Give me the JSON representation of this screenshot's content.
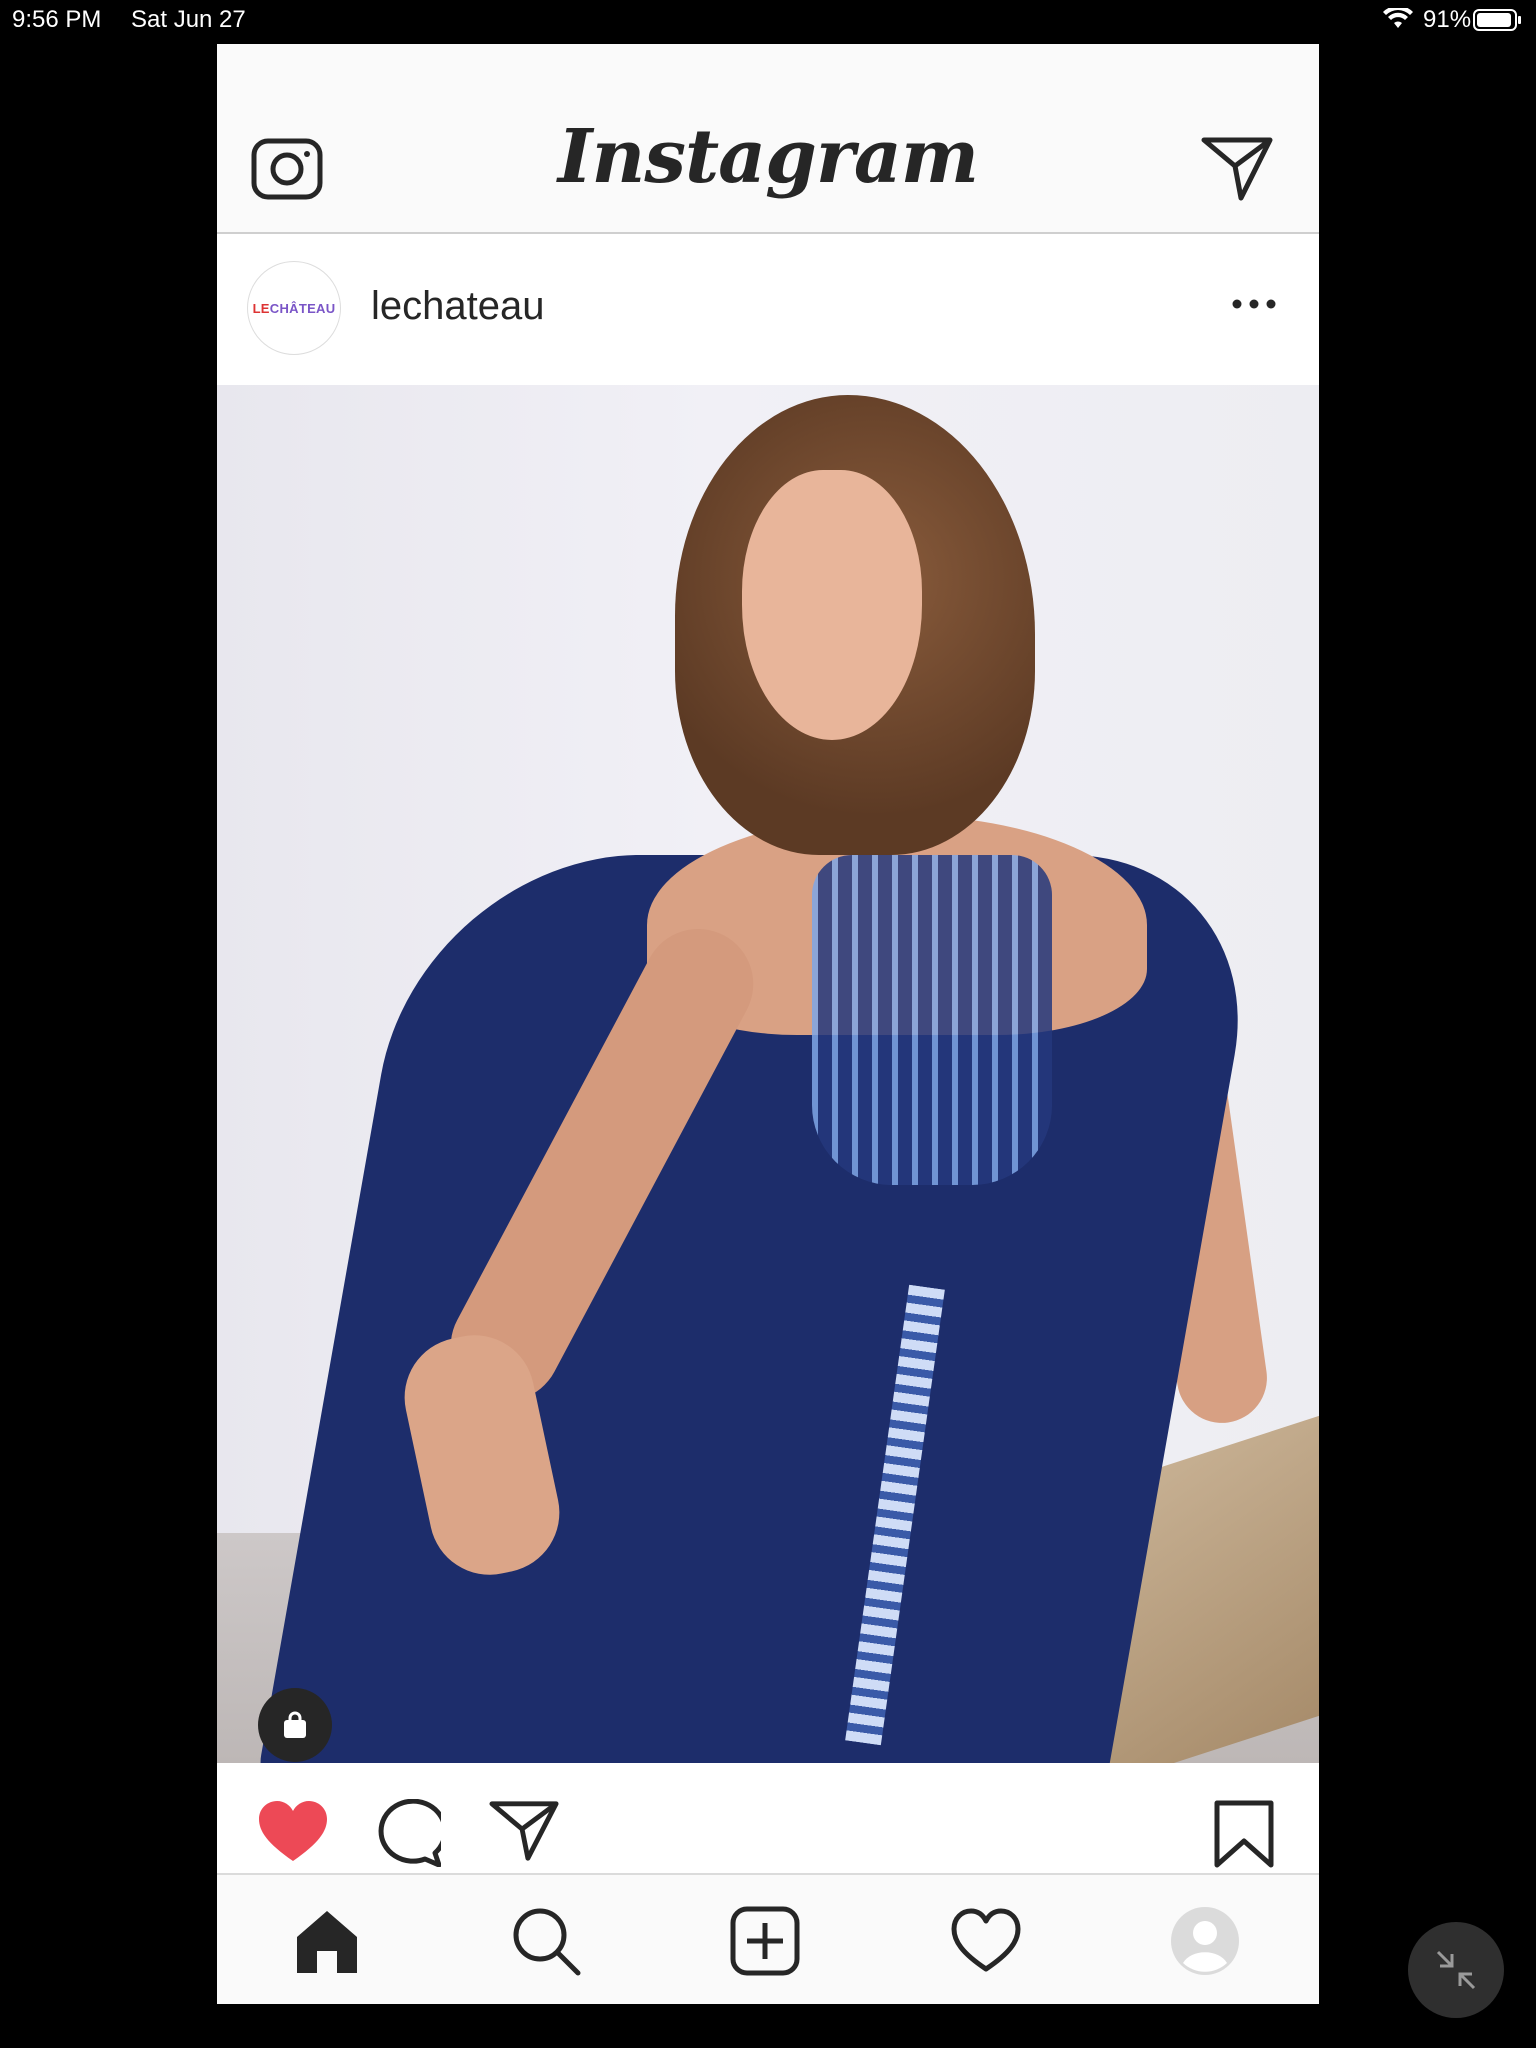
{
  "status_bar": {
    "time": "9:56 PM",
    "date": "Sat Jun 27",
    "battery_pct": "91%"
  },
  "app": {
    "brand": "Instagram"
  },
  "post": {
    "username": "lechateau",
    "avatar_text_a": "LE ",
    "avatar_text_b": "CHÂTEAU",
    "liked": true,
    "like_color": "#ed4956"
  },
  "icons": {
    "camera": "camera-icon",
    "direct": "paper-plane-icon",
    "more": "ellipsis-icon",
    "shop": "shopping-bag-icon",
    "like": "heart-icon",
    "comment": "comment-icon",
    "share": "paper-plane-icon",
    "save": "bookmark-icon",
    "home": "home-icon",
    "search": "search-icon",
    "add": "add-post-icon",
    "activity": "heart-outline-icon",
    "profile": "profile-icon",
    "minimize": "minimize-icon"
  }
}
